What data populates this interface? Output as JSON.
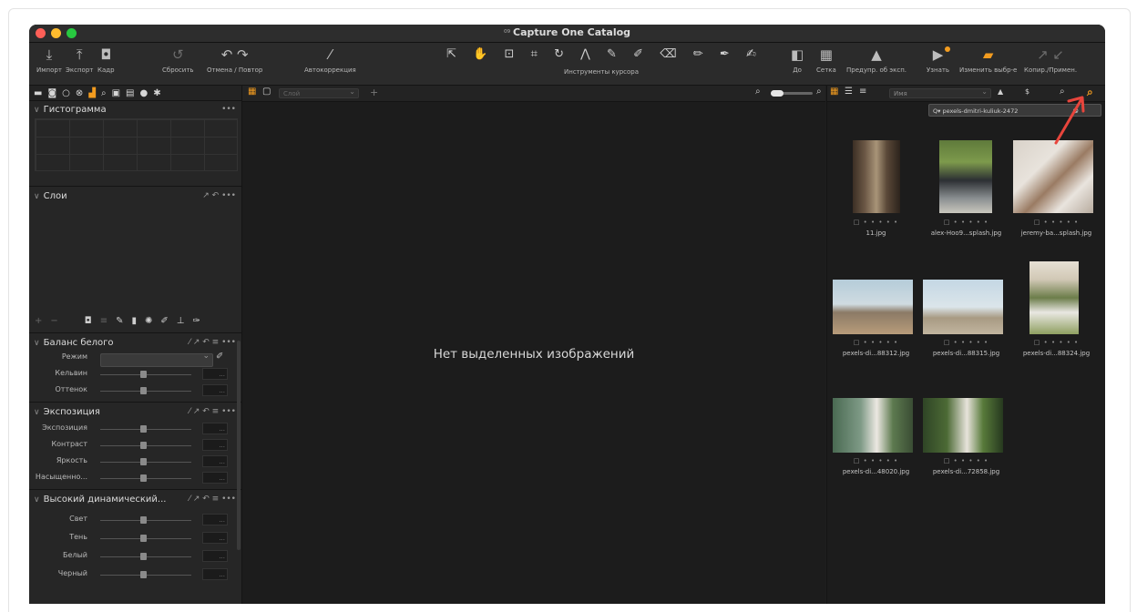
{
  "window": {
    "title": "Capture One Catalog",
    "title_icon": "catalog-icon"
  },
  "traffic_lights": {
    "close": "#fe5f57",
    "minimize": "#febc2e",
    "zoom": "#28c840"
  },
  "toolbar": {
    "import": "Импорт",
    "export": "Экспорт",
    "capture": "Кадр",
    "reset": "Сбросить",
    "undo_redo": "Отмена / Повтор",
    "auto_adjust": "Автокоррекция",
    "cursor_tools": "Инструменты курсора",
    "before": "До",
    "grid": "Сетка",
    "exposure_warning": "Предупр. об эксп.",
    "find_out": "Узнать",
    "edit_selected": "Изменить выбр-е",
    "copy_apply": "Копир./Примен."
  },
  "accent_color": "#f39c1f",
  "left_panel": {
    "histogram_title": "Гистограмма",
    "layers_title": "Слои",
    "white_balance": {
      "title": "Баланс белого",
      "mode_label": "Режим",
      "kelvin_label": "Кельвин",
      "tint_label": "Оттенок"
    },
    "exposure": {
      "title": "Экспозиция",
      "exposure_label": "Экспозиция",
      "contrast_label": "Контраст",
      "brightness_label": "Яркость",
      "saturation_label": "Насыщенно..."
    },
    "hdr": {
      "title": "Высокий динамический...",
      "highlight_label": "Свет",
      "shadow_label": "Тень",
      "white_label": "Белый",
      "black_label": "Черный"
    }
  },
  "viewer": {
    "layer_placeholder": "Слой",
    "empty_message": "Нет выделенных изображений"
  },
  "browser": {
    "sort_value": "Имя",
    "search_value": "Q▾ pexels-dmitri-kuliuk-2472",
    "images": [
      {
        "file": "11.jpg",
        "rating": "□ • • • • •"
      },
      {
        "file": "alex-Hoo9...splash.jpg",
        "rating": "□ • • • • •"
      },
      {
        "file": "jeremy-ba...splash.jpg",
        "rating": "□ • • • • •"
      },
      {
        "file": "pexels-di...88312.jpg",
        "rating": "□ • • • • •"
      },
      {
        "file": "pexels-di...88315.jpg",
        "rating": "□ • • • • •"
      },
      {
        "file": "pexels-di...88324.jpg",
        "rating": "□ • • • • •"
      },
      {
        "file": "pexels-di...48020.jpg",
        "rating": "□ • • • • •"
      },
      {
        "file": "pexels-di...72858.jpg",
        "rating": "□ • • • • •"
      }
    ]
  }
}
